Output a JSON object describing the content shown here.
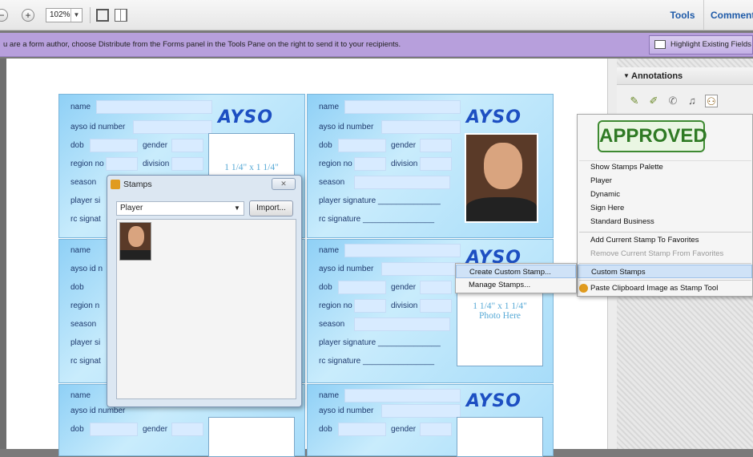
{
  "toolbar": {
    "zoom": "102%",
    "tools_tab": "Tools",
    "comment_tab": "Comment"
  },
  "infobar": {
    "text": "u are a form author, choose Distribute from the Forms panel in the Tools Pane on the right to send it to your recipients.",
    "highlight_button": "Highlight Existing Fields"
  },
  "annotations": {
    "title": "Annotations"
  },
  "card": {
    "logo": "AYSO",
    "name": "name",
    "id": "ayso id number",
    "dob": "dob",
    "gender": "gender",
    "region": "region no",
    "division": "division",
    "season": "season",
    "player_sig": "player signature ______________",
    "rc_sig": "rc signature ________________",
    "player_sig_short": "player si",
    "rc_sig_short": "rc signat",
    "name_short": "name",
    "id_short": "ayso id n",
    "region_short": "region n",
    "photo_size": "1 1/4\" x 1 1/4\"",
    "photo_here": "Photo Here"
  },
  "stamps_window": {
    "title": "Stamps",
    "category": "Player",
    "import": "Import..."
  },
  "stamp_menu": {
    "approved": "APPROVED",
    "items": [
      "Show Stamps Palette",
      "Player",
      "Dynamic",
      "Sign Here",
      "Standard Business"
    ],
    "add_favorites": "Add Current Stamp To Favorites",
    "remove_favorites": "Remove Current Stamp From Favorites",
    "custom_stamps": "Custom Stamps",
    "paste_clipboard": "Paste Clipboard Image as Stamp Tool"
  },
  "custom_submenu": {
    "create": "Create Custom Stamp...",
    "manage": "Manage Stamps..."
  }
}
